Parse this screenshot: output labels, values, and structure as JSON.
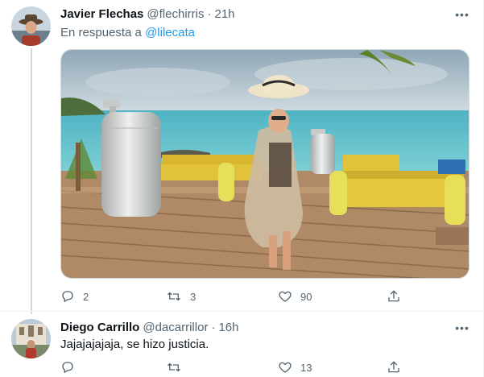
{
  "tweet1": {
    "name": "Javier Flechas",
    "handle": "@flechirris",
    "dot": "·",
    "time": "21h",
    "reply_prefix": "En respuesta a ",
    "reply_mention": "@lilecata",
    "replies": "2",
    "retweets": "3",
    "likes": "90"
  },
  "tweet2": {
    "name": "Diego Carrillo",
    "handle": "@dacarrillor",
    "dot": "·",
    "time": "16h",
    "text": "Jajajajajaja, se hizo justicia.",
    "replies": "",
    "retweets": "",
    "likes": "13"
  },
  "more_glyph": "•••",
  "colors": {
    "accent": "#1d9bf0",
    "secondary_text": "#536471",
    "primary_text": "#0f1419",
    "thread_line": "#cfd9de"
  },
  "icons": [
    "reply-icon",
    "retweet-icon",
    "like-icon",
    "share-icon",
    "more-icon"
  ]
}
